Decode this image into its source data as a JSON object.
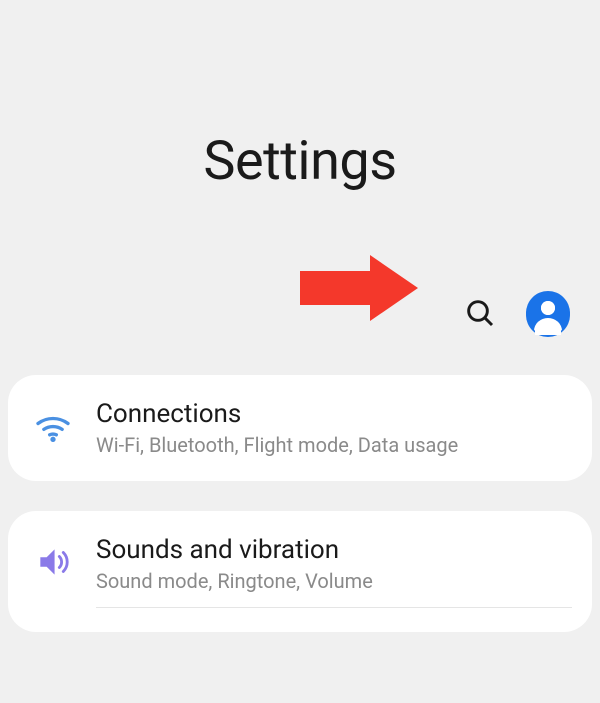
{
  "header": {
    "title": "Settings"
  },
  "toolbar": {
    "search_icon": "search",
    "profile_icon": "account"
  },
  "items": [
    {
      "title": "Connections",
      "subtitle": "Wi-Fi, Bluetooth, Flight mode, Data usage",
      "icon": "wifi"
    },
    {
      "title": "Sounds and vibration",
      "subtitle": "Sound mode, Ringtone, Volume",
      "icon": "sound"
    }
  ],
  "annotation": {
    "arrow_color": "#f4382b"
  }
}
